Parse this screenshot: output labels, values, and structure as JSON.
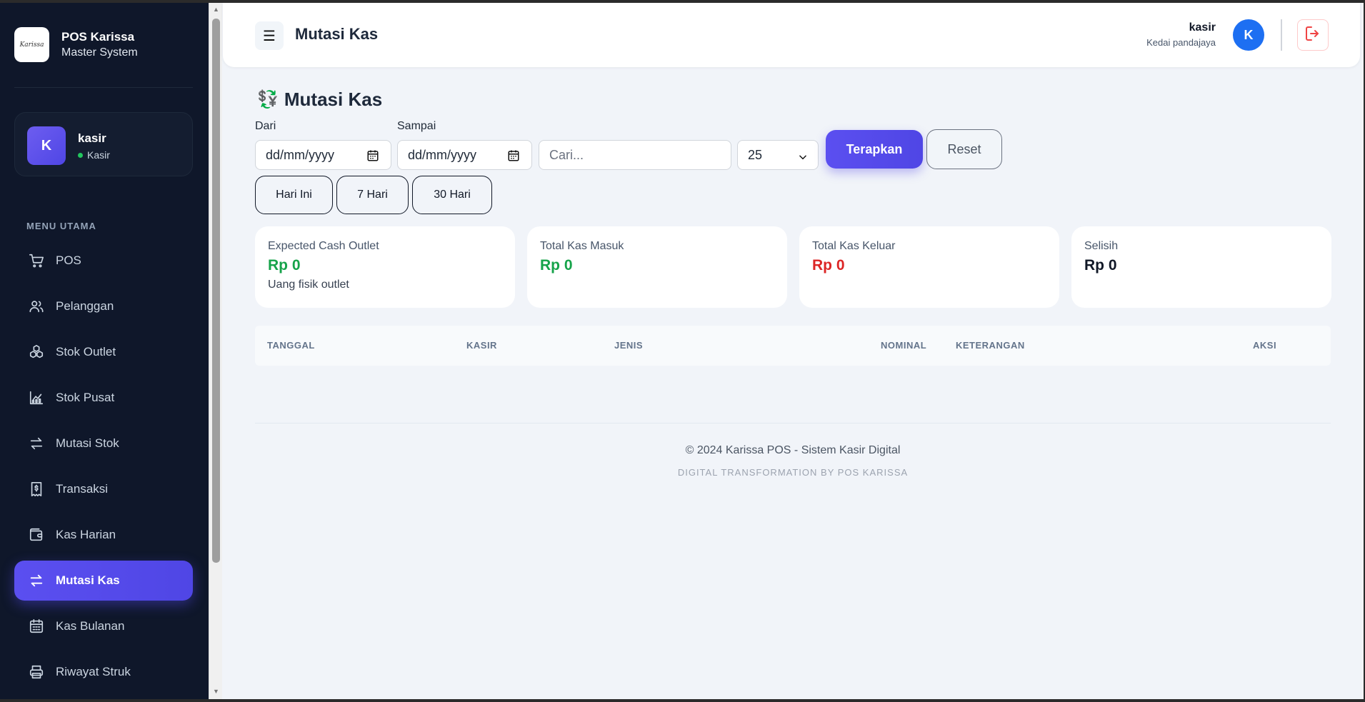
{
  "brand": {
    "logo_text": "Karissa",
    "title": "POS Karissa",
    "subtitle": "Master System"
  },
  "user_card": {
    "initial": "K",
    "name": "kasir",
    "role": "Kasir"
  },
  "sidebar": {
    "heading": "MENU UTAMA",
    "items": [
      {
        "label": "POS",
        "icon": "cart-icon"
      },
      {
        "label": "Pelanggan",
        "icon": "users-icon"
      },
      {
        "label": "Stok Outlet",
        "icon": "boxes-icon"
      },
      {
        "label": "Stok Pusat",
        "icon": "chart-icon"
      },
      {
        "label": "Mutasi Stok",
        "icon": "transfer-icon"
      },
      {
        "label": "Transaksi",
        "icon": "receipt-icon"
      },
      {
        "label": "Kas Harian",
        "icon": "wallet-icon"
      },
      {
        "label": "Mutasi Kas",
        "icon": "transfer-icon",
        "active": true
      },
      {
        "label": "Kas Bulanan",
        "icon": "calendar-icon"
      },
      {
        "label": "Riwayat Struk",
        "icon": "printer-icon"
      }
    ]
  },
  "topbar": {
    "title": "Mutasi Kas",
    "user_name": "kasir",
    "store_name": "Kedai pandajaya",
    "avatar_initial": "K"
  },
  "page": {
    "title": "Mutasi Kas",
    "title_icon": "💱"
  },
  "filters": {
    "from_label": "Dari",
    "from_value": "dd/mm/yyyy",
    "to_label": "Sampai",
    "to_value": "dd/mm/yyyy",
    "search_placeholder": "Cari...",
    "per_page": "25",
    "apply_label": "Terapkan",
    "reset_label": "Reset",
    "ranges": [
      "Hari Ini",
      "7 Hari",
      "30 Hari"
    ]
  },
  "summary": [
    {
      "label": "Expected Cash Outlet",
      "value": "Rp 0",
      "note": "Uang fisik outlet",
      "color": "#16a34a"
    },
    {
      "label": "Total Kas Masuk",
      "value": "Rp 0",
      "color": "#16a34a"
    },
    {
      "label": "Total Kas Keluar",
      "value": "Rp 0",
      "color": "#dc2626"
    },
    {
      "label": "Selisih",
      "value": "Rp 0",
      "color": "#111827"
    }
  ],
  "table": {
    "columns": [
      "TANGGAL",
      "KASIR",
      "JENIS",
      "NOMINAL",
      "KETERANGAN",
      "AKSI"
    ]
  },
  "footer": {
    "copyright": "© 2024 Karissa POS - Sistem Kasir Digital",
    "tagline": "DIGITAL TRANSFORMATION BY POS KARISSA"
  }
}
